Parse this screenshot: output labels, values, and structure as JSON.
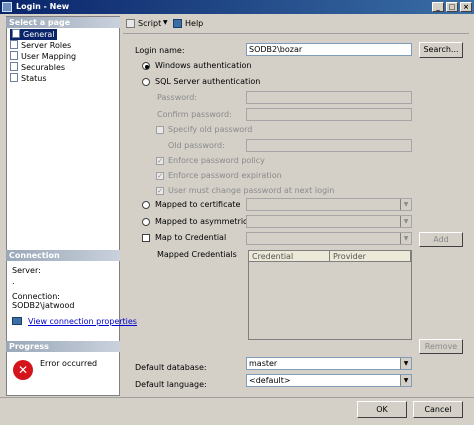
{
  "window": {
    "title": "Login - New"
  },
  "left": {
    "select_page_header": "Select a page",
    "pages": [
      "General",
      "Server Roles",
      "User Mapping",
      "Securables",
      "Status"
    ],
    "connection_header": "Connection",
    "server_label": "Server:",
    "server_value": ".",
    "connection_label": "Connection:",
    "connection_value": "SODB2\\jatwood",
    "view_connection_link": "View connection properties",
    "progress_header": "Progress",
    "progress_status": "Error occurred"
  },
  "toolbar": {
    "script_label": "Script",
    "help_label": "Help"
  },
  "form": {
    "login_name_label": "Login name:",
    "login_name_value": "SODB2\\bozar",
    "search_button": "Search...",
    "windows_auth": "Windows authentication",
    "sql_auth": "SQL Server authentication",
    "password_label": "Password:",
    "confirm_password_label": "Confirm password:",
    "specify_old_password": "Specify old password",
    "old_password_label": "Old password:",
    "enforce_policy": "Enforce password policy",
    "enforce_expiration": "Enforce password expiration",
    "must_change": "User must change password at next login",
    "mapped_to_certificate": "Mapped to certificate",
    "mapped_to_asym_key": "Mapped to asymmetric key",
    "map_to_credential": "Map to Credential",
    "add_button": "Add",
    "mapped_credentials_label": "Mapped Credentials",
    "credential_col": "Credential",
    "provider_col": "Provider",
    "remove_button": "Remove",
    "default_database_label": "Default database:",
    "default_database_value": "master",
    "default_language_label": "Default language:",
    "default_language_value": "<default>"
  },
  "buttons": {
    "ok": "OK",
    "cancel": "Cancel"
  },
  "window_controls": {
    "minimize": "_",
    "maximize": "□",
    "close": "×"
  }
}
